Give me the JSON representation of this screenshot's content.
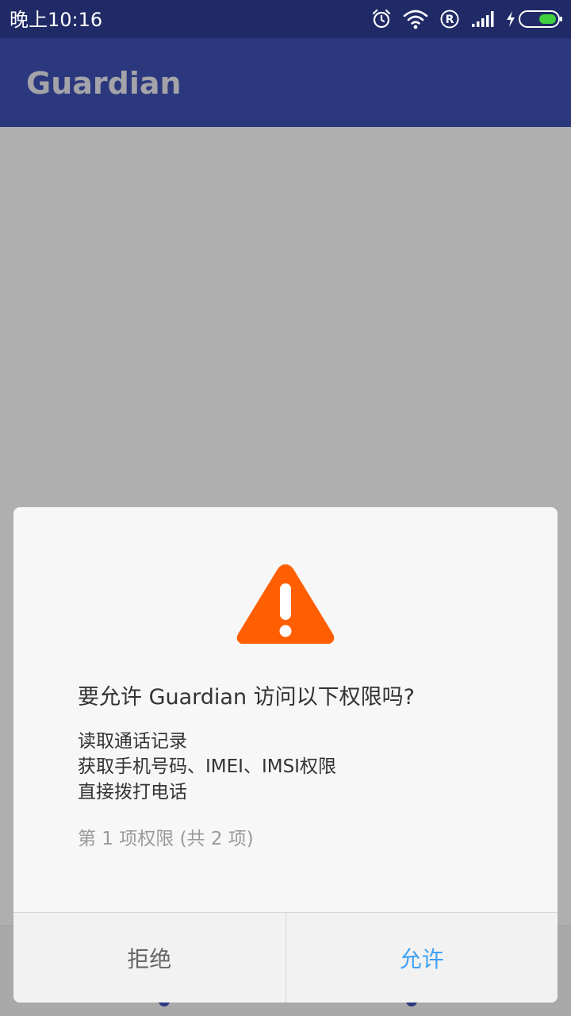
{
  "status_bar": {
    "time": "晚上10:16",
    "icons": [
      "alarm-icon",
      "wifi-icon",
      "roaming-r-icon",
      "signal-icon",
      "charging-icon",
      "battery-icon"
    ],
    "battery_color": "#3fcf3f"
  },
  "app_bar": {
    "title": "Guardian",
    "color": "#2c387e"
  },
  "dialog": {
    "icon": "warning-icon",
    "icon_color": "#ff5f00",
    "title": "要允许 Guardian 访问以下权限吗?",
    "permissions": [
      "读取通话记录",
      "获取手机号码、IMEI、IMSI权限",
      "直接拨打电话"
    ],
    "progress_text": "第 1 项权限 (共 2 项)",
    "deny_label": "拒绝",
    "allow_label": "允许",
    "allow_color": "#3ea1f3"
  }
}
